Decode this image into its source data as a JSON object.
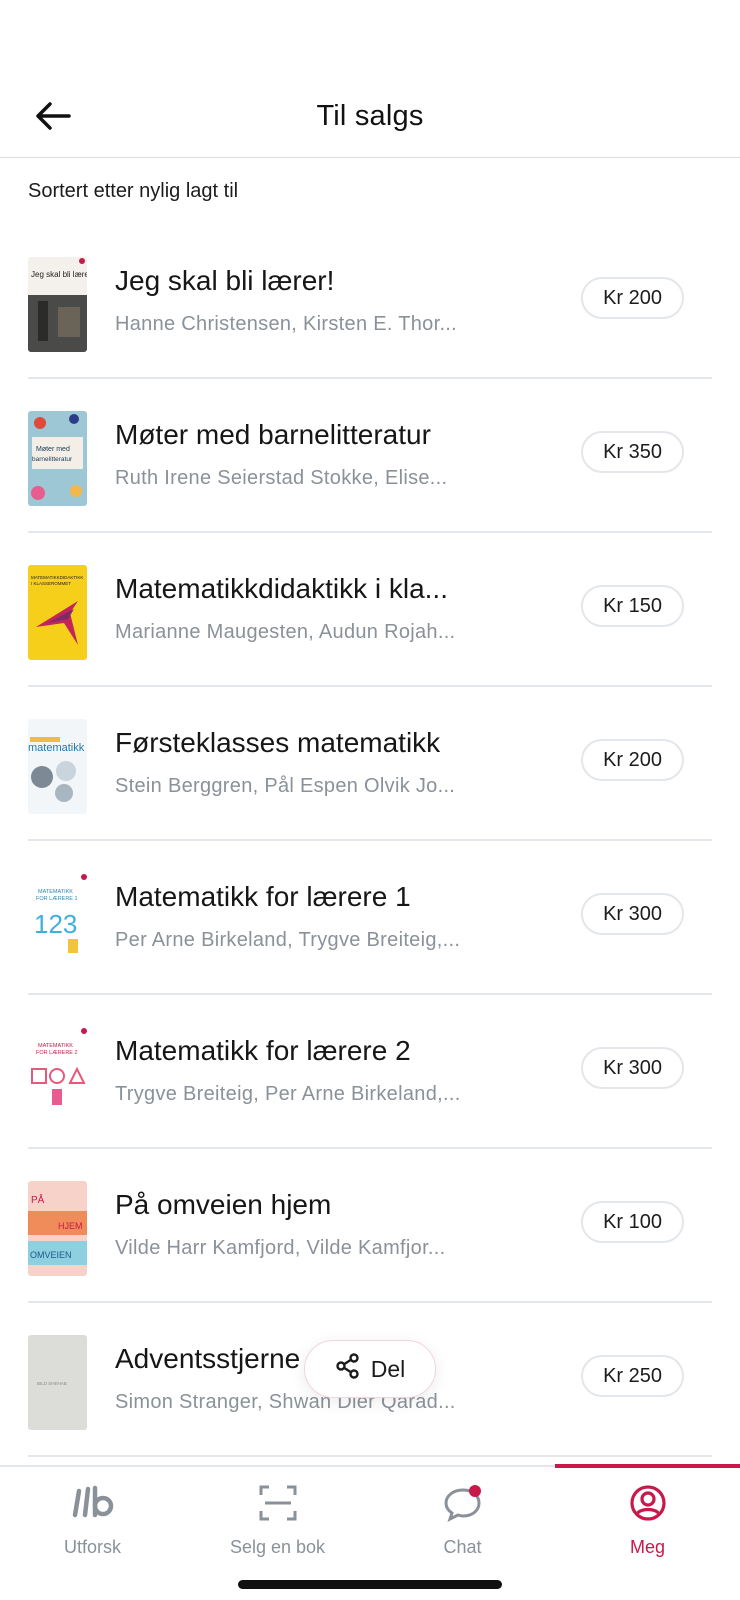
{
  "header": {
    "title": "Til salgs",
    "back_icon": "arrow-left-icon"
  },
  "sort_label": "Sortert etter nylig lagt til",
  "books": [
    {
      "title": "Jeg skal bli lærer!",
      "authors": "Hanne Christensen, Kirsten E. Thor...",
      "price": "Kr 200",
      "cover_color": "#f4f1ec",
      "cover_text": "Jeg skal bli lærer!"
    },
    {
      "title": "Møter med barnelitteratur",
      "authors": "Ruth Irene Seierstad Stokke, Elise...",
      "price": "Kr 350",
      "cover_color": "#9ec7d6",
      "cover_text": "Møter med barnelitteratur"
    },
    {
      "title": "Matematikkdidaktikk i kla...",
      "authors": "Marianne Maugesten, Audun Rojah...",
      "price": "Kr 150",
      "cover_color": "#f5cf1a",
      "cover_text": "MATEMATIKKDIDAKTIKK I KLASSEROMMET"
    },
    {
      "title": "Førsteklasses matematikk",
      "authors": "Stein Berggren, Pål Espen Olvik Jo...",
      "price": "Kr 200",
      "cover_color": "#f3f6f8",
      "cover_text": "matematikk"
    },
    {
      "title": "Matematikk for lærere 1",
      "authors": "Per Arne Birkeland, Trygve Breiteig,...",
      "price": "Kr 300",
      "cover_color": "#ffffff",
      "cover_text": "MATEMATIKK FOR LÆRERE 1"
    },
    {
      "title": "Matematikk for lærere 2",
      "authors": "Trygve Breiteig, Per Arne Birkeland,...",
      "price": "Kr 300",
      "cover_color": "#ffffff",
      "cover_text": "MATEMATIKK FOR LÆRERE 2"
    },
    {
      "title": "På omveien hjem",
      "authors": "Vilde Harr Kamfjord, Vilde Kamfjor...",
      "price": "Kr 100",
      "cover_color": "#f08c5a",
      "cover_text": "PÅ OMVEIEN HJEM"
    },
    {
      "title": "Adventsstjerne",
      "authors": "Simon Stranger, Shwan Dler Qarad...",
      "price": "Kr 250",
      "cover_color": "#dcdcd8",
      "cover_text": "BILD SHEHAB"
    }
  ],
  "share": {
    "label": "Del",
    "icon": "share-icon"
  },
  "tabs": [
    {
      "label": "Utforsk",
      "icon": "lb-logo-icon",
      "active": false
    },
    {
      "label": "Selg en bok",
      "icon": "scan-icon",
      "active": false
    },
    {
      "label": "Chat",
      "icon": "chat-bubble-icon",
      "active": false
    },
    {
      "label": "Meg",
      "icon": "user-circle-icon",
      "active": true
    }
  ],
  "colors": {
    "accent": "#c8194b",
    "muted_text": "#8a9199",
    "divider": "#e3e6ea"
  }
}
